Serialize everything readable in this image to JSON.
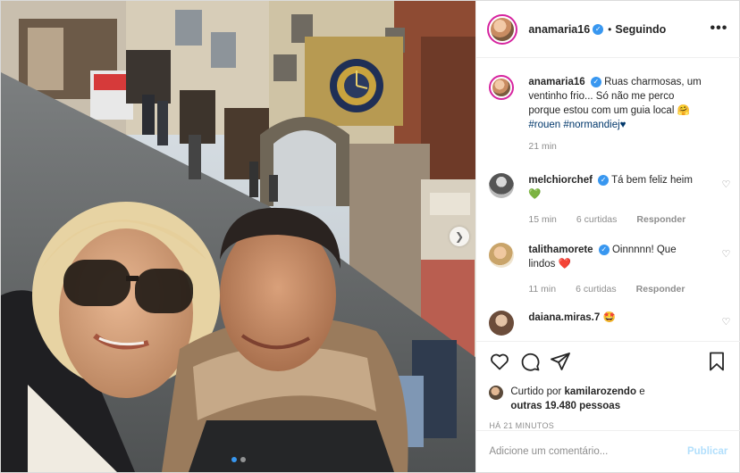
{
  "post": {
    "author": "anamaria16",
    "follow_state": "Seguindo",
    "more_icon": "more-options-icon",
    "caption": {
      "username": "anamaria16",
      "text": "Ruas charmosas, um ventinho frio... Só não me perco porque estou com um guia local 🤗",
      "hashtags": "#rouen #normandiej♥",
      "time": "21 min"
    },
    "comments": [
      {
        "username": "melchiorchef",
        "text": "Tá bem feliz heim",
        "emoji": "💚",
        "time": "15 min",
        "likes": "6 curtidas",
        "reply": "Responder"
      },
      {
        "username": "talithamorete",
        "text": "Oinnnnn! Que lindos",
        "emoji": "❤️",
        "time": "11 min",
        "likes": "6 curtidas",
        "reply": "Responder"
      },
      {
        "username": "daiana.miras.7",
        "text": "🤩"
      }
    ],
    "liked_by_prefix": "Curtido por",
    "liked_by_user": "kamilarozendo",
    "liked_by_and": "e",
    "liked_by_others": "outras 19.480 pessoas",
    "posted_ago": "HÁ 21 MINUTOS",
    "comment_placeholder": "Adicione um comentário...",
    "publish_label": "Publicar"
  },
  "carousel": {
    "count": 2,
    "active": 0
  },
  "colors": {
    "accent": "#3897f0",
    "link": "#00376b",
    "muted": "#8e8e8e",
    "publish_disabled": "#b2dffc",
    "story_ring": "#d6249f"
  }
}
